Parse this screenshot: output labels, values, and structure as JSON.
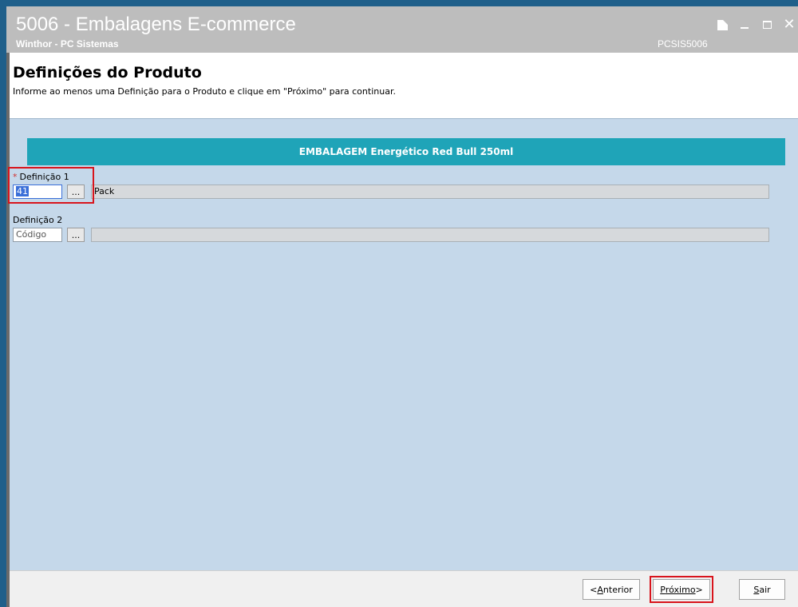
{
  "window": {
    "title": "5006 - Embalagens E-commerce",
    "subtitle": "Winthor - PC Sistemas",
    "routine_code": "PCSIS5006",
    "controls": {
      "close": "✕"
    }
  },
  "header": {
    "title": "Definições do Produto",
    "hint": "Informe ao menos uma Definição para o Produto e clique em \"Próximo\" para continuar."
  },
  "product_bar": {
    "text": "EMBALAGEM Energético Red Bull 250ml"
  },
  "fields": [
    {
      "required_marker": "*",
      "label": "Definição 1",
      "code_value": "41",
      "lookup_label": "...",
      "description": "Pack"
    },
    {
      "label": "Definição 2",
      "code_placeholder": "Código",
      "lookup_label": "...",
      "description": ""
    }
  ],
  "footer": {
    "prev": {
      "mnemonic": "A",
      "rest": "nterior",
      "prefix": "< "
    },
    "next": {
      "mnemonic": "P",
      "rest": "róximo",
      "suffix": " >"
    },
    "exit": {
      "mnemonic": "S",
      "rest": "air"
    }
  },
  "colors": {
    "accent_bar": "#1fa4b8",
    "panel": "#c5d8ea",
    "highlight": "#d8141c"
  }
}
